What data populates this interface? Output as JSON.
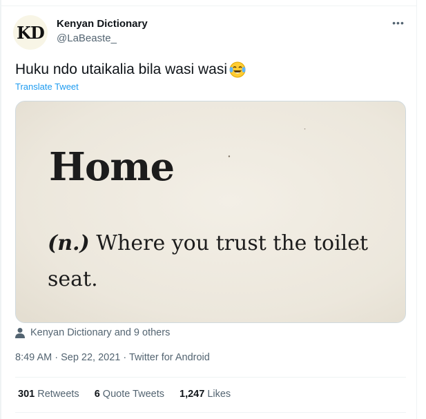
{
  "author": {
    "avatar_text": "KD",
    "name": "Kenyan Dictionary",
    "handle": "@LaBeaste_"
  },
  "tweet": {
    "text": "Huku ndo utaikalia bila wasi wasi",
    "emoji_icon": "face-with-tears-of-joy-icon",
    "translate_label": "Translate Tweet"
  },
  "media": {
    "headword": "Home",
    "part_of_speech": "(n.)",
    "definition_line1": " Where you trust the toilet",
    "definition_line2": "seat."
  },
  "tagged": "Kenyan Dictionary and 9 others",
  "meta": "8:49 AM · Sep 22, 2021 · Twitter for Android",
  "stats": {
    "retweets_count": "301",
    "retweets_label": " Retweets",
    "quotes_count": "6",
    "quotes_label": " Quote Tweets",
    "likes_count": "1,247",
    "likes_label": " Likes"
  },
  "colors": {
    "link": "#1d9bf0",
    "secondary_text": "#536471",
    "primary_text": "#0f1419",
    "card_bg": "#efebe1"
  }
}
